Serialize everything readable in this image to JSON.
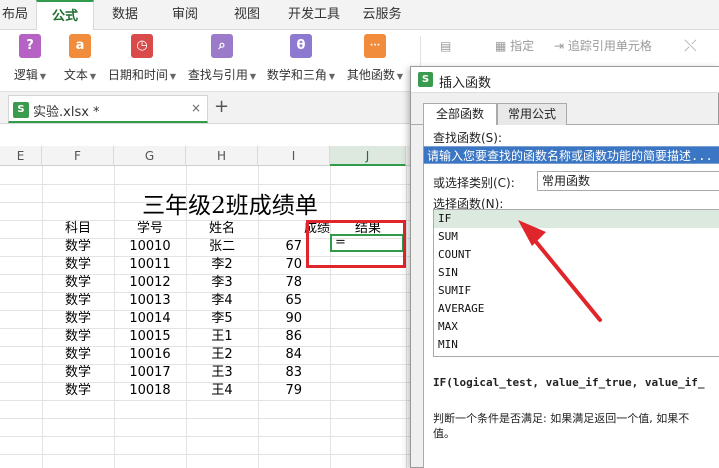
{
  "menu_tabs": [
    {
      "label": "布局",
      "active": false
    },
    {
      "label": "公式",
      "active": true
    },
    {
      "label": "数据",
      "active": false
    },
    {
      "label": "审阅",
      "active": false
    },
    {
      "label": "视图",
      "active": false
    },
    {
      "label": "开发工具",
      "active": false
    },
    {
      "label": "云服务",
      "active": false
    }
  ],
  "ribbon": {
    "buttons": [
      {
        "label": "逻辑",
        "icon": "logic-icon",
        "glyph": "?",
        "color": "#b562c4"
      },
      {
        "label": "文本",
        "icon": "text-icon",
        "glyph": "a",
        "color": "#f08c3c"
      },
      {
        "label": "日期和时间",
        "icon": "clock-icon",
        "glyph": "◷",
        "color": "#d94b4b"
      },
      {
        "label": "查找与引用",
        "icon": "lookup-icon",
        "glyph": "⌕",
        "color": "#9a7ac9"
      },
      {
        "label": "数学和三角",
        "icon": "math-icon",
        "glyph": "θ",
        "color": "#8d7ad0"
      },
      {
        "label": "其他函数",
        "icon": "other-functions-icon",
        "glyph": "···",
        "color": "#f08c3c"
      }
    ],
    "trace_precedents": "指定",
    "trace_dependents": "追踪引用单元格"
  },
  "file_tab": {
    "name": "实验.xlsx *",
    "close": "×",
    "new_tab": "+"
  },
  "sheet": {
    "columns": [
      "E",
      "F",
      "G",
      "H",
      "I",
      "J"
    ],
    "title": "三年级2班成绩单",
    "headers": [
      "科目",
      "学号",
      "姓名",
      "成绩",
      "结果"
    ],
    "rows": [
      {
        "subject": "数学",
        "id": "10010",
        "name": "张二",
        "score": "67"
      },
      {
        "subject": "数学",
        "id": "10011",
        "name": "李2",
        "score": "70"
      },
      {
        "subject": "数学",
        "id": "10012",
        "name": "李3",
        "score": "78"
      },
      {
        "subject": "数学",
        "id": "10013",
        "name": "李4",
        "score": "65"
      },
      {
        "subject": "数学",
        "id": "10014",
        "name": "李5",
        "score": "90"
      },
      {
        "subject": "数学",
        "id": "10015",
        "name": "王1",
        "score": "86"
      },
      {
        "subject": "数学",
        "id": "10016",
        "name": "王2",
        "score": "84"
      },
      {
        "subject": "数学",
        "id": "10017",
        "name": "王3",
        "score": "83"
      },
      {
        "subject": "数学",
        "id": "10018",
        "name": "王4",
        "score": "79"
      }
    ],
    "active_cell_value": "="
  },
  "dialog": {
    "title": "插入函数",
    "tabs": [
      "全部函数",
      "常用公式"
    ],
    "search_label": "查找函数(S):",
    "search_value": "请输入您要查找的函数名称或函数功能的简要描述...",
    "category_label": "或选择类别(C):",
    "category_value": "常用函数",
    "select_label": "选择函数(N):",
    "functions": [
      "IF",
      "SUM",
      "COUNT",
      "SIN",
      "SUMIF",
      "AVERAGE",
      "MAX",
      "MIN"
    ],
    "selected_function": "IF",
    "signature": "IF(logical_test, value_if_true, value_if_",
    "description_line1": "判断一个条件是否满足: 如果满足返回一个值, 如果不",
    "description_line2": "值。"
  },
  "colors": {
    "accent": "#2f9b4b",
    "highlight": "#e0262a"
  }
}
